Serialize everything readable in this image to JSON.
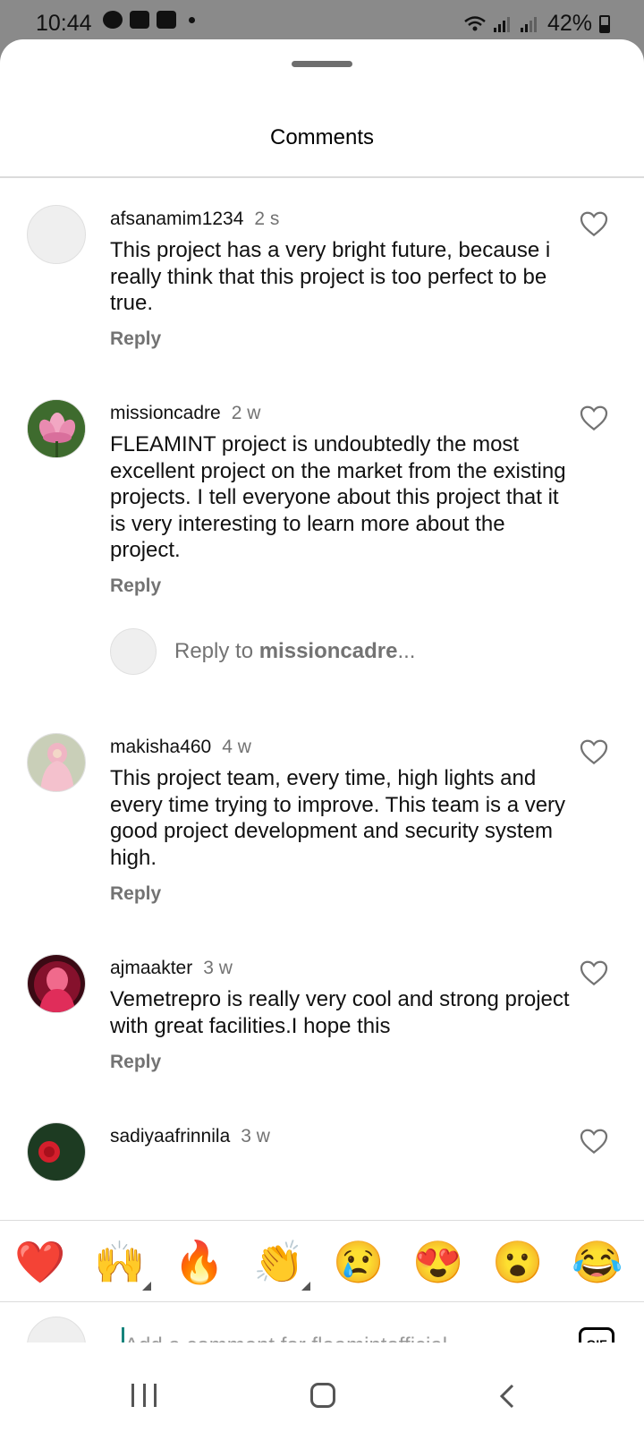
{
  "status_bar": {
    "time": "10:44",
    "battery": "42%",
    "left_icons": [
      "chat-bubble-icon",
      "gallery-icon",
      "youtube-icon",
      "dot-icon"
    ],
    "right_icons": [
      "wifi-icon",
      "signal-icon",
      "signal-icon",
      "battery-icon"
    ]
  },
  "sheet": {
    "title": "Comments"
  },
  "comments": [
    {
      "username": "afsanamim1234",
      "time": "2 s",
      "text": "This project has a very bright future, because i really think that this project is too perfect to be true.",
      "reply_label": "Reply",
      "avatar": "placeholder"
    },
    {
      "username": "missioncadre",
      "time": "2 w",
      "text": "FLEAMINT project is undoubtedly the most excellent project on the market from the existing projects. I tell everyone about this project that it is very interesting to learn more about the project.",
      "reply_label": "Reply",
      "avatar": "lotus-flower"
    },
    {
      "username": "makisha460",
      "time": "4 w",
      "text": "This project team, every time, high lights and every time trying to improve. This team is a very good project development and security system high.",
      "reply_label": "Reply",
      "avatar": "person-pink-hijab"
    },
    {
      "username": "ajmaakter",
      "time": "3 w",
      "text": "Vemetrepro is really very cool and strong project with great facilities.I hope this",
      "reply_label": "Reply",
      "avatar": "person-red"
    },
    {
      "username": "sadiyaafrinnila",
      "time": "3 w",
      "avatar": "red-flower"
    }
  ],
  "reply_to": {
    "prefix": "Reply to ",
    "username": "missioncadre",
    "suffix": "..."
  },
  "emoji_bar": [
    "❤️",
    "🙌",
    "🔥",
    "👏",
    "😢",
    "😍",
    "😮",
    "😂"
  ],
  "comment_input": {
    "placeholder": "Add a comment for fleamintofficial...",
    "gif_label": "GIF"
  },
  "colors": {
    "text": "#111111",
    "secondary": "#737373",
    "divider": "#dbdbdb",
    "cursor": "#16847c"
  }
}
